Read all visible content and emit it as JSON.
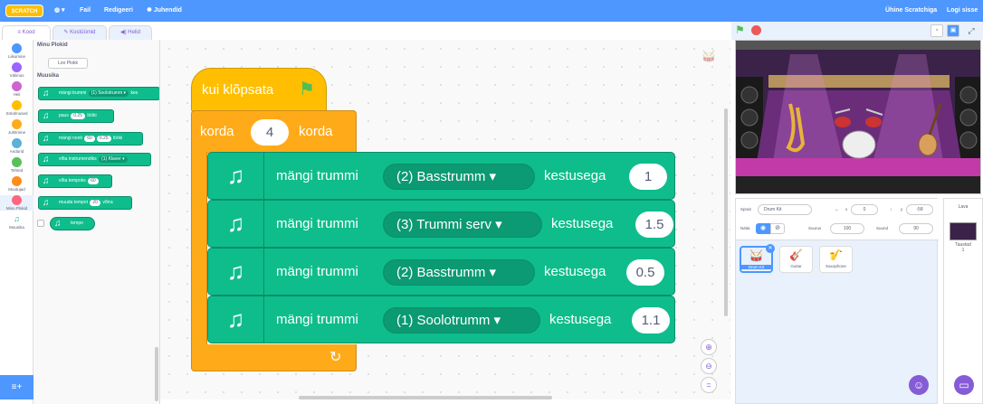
{
  "topbar": {
    "logo": "SCRATCH",
    "file": "Fail",
    "edit": "Redigeeri",
    "tutorials": "Juhendid",
    "share": "Ühine Scratchiga",
    "signin": "Logi sisse",
    "globe_icon": "globe-icon",
    "bulb_icon": "lightbulb-icon"
  },
  "tabs": {
    "code": "Kood",
    "costumes": "Kostüümid",
    "sounds": "Helid"
  },
  "categories": [
    {
      "label": "Liikumine",
      "color": "#4c97ff"
    },
    {
      "label": "Välimus",
      "color": "#9966ff"
    },
    {
      "label": "Heli",
      "color": "#cf63cf"
    },
    {
      "label": "Sündmused",
      "color": "#ffbf00"
    },
    {
      "label": "Juhtimine",
      "color": "#ffab19"
    },
    {
      "label": "Andurid",
      "color": "#5cb1d6"
    },
    {
      "label": "Tehted",
      "color": "#59c059"
    },
    {
      "label": "Muutujad",
      "color": "#ff8c1a"
    },
    {
      "label": "Minu Plokid",
      "color": "#ff6680"
    },
    {
      "label": "Muusika",
      "color": "#0fbd8c"
    }
  ],
  "palette": {
    "my_blocks": "Minu Plokid",
    "make_block": "Loo Plokk",
    "music": "Muusika",
    "blocks": [
      {
        "text": "mängi trummi",
        "input": "(1) Soolotrumm ▾",
        "after": "kes"
      },
      {
        "text": "paus",
        "input": "0.25",
        "after": "lööki"
      },
      {
        "text": "mängi nooti",
        "input": "60",
        "input2": "0.25",
        "after": "lööki"
      },
      {
        "text": "vőta instrumendiks",
        "input": "(1) Klaver ▾",
        "after": ""
      },
      {
        "text": "vőta tempoks",
        "input": "60",
        "after": ""
      },
      {
        "text": "muuda tempot",
        "input": "20",
        "after": "vőrra"
      },
      {
        "text": "tempo",
        "input": "",
        "after": ""
      }
    ]
  },
  "script": {
    "hat": "kui klõpsata",
    "repeat_label": "korda",
    "repeat_count": "4",
    "repeat_suffix": "korda",
    "play_label": "mängi trummi",
    "duration_label": "kestusega",
    "blocks": [
      {
        "drum": "(2) Basstrumm",
        "beats": "1"
      },
      {
        "drum": "(3) Trummi serv",
        "beats": "1.5"
      },
      {
        "drum": "(2) Basstrumm",
        "beats": "0.5"
      },
      {
        "drum": "(1) Soolotrumm",
        "beats": "1.1"
      }
    ]
  },
  "sprite": {
    "label": "Sprait",
    "name": "Drum Kit",
    "x_label": "x",
    "x": "0",
    "y_label": "y",
    "y": "-58",
    "show_label": "Näita",
    "size_label": "Suurus",
    "size": "100",
    "direction_label": "Suund",
    "direction": "90"
  },
  "sprites": [
    "Drum Kit",
    "Guitar",
    "Saxophone"
  ],
  "stage": {
    "title": "Lava",
    "backdrops_label": "Taustad",
    "backdrops_count": "1"
  }
}
